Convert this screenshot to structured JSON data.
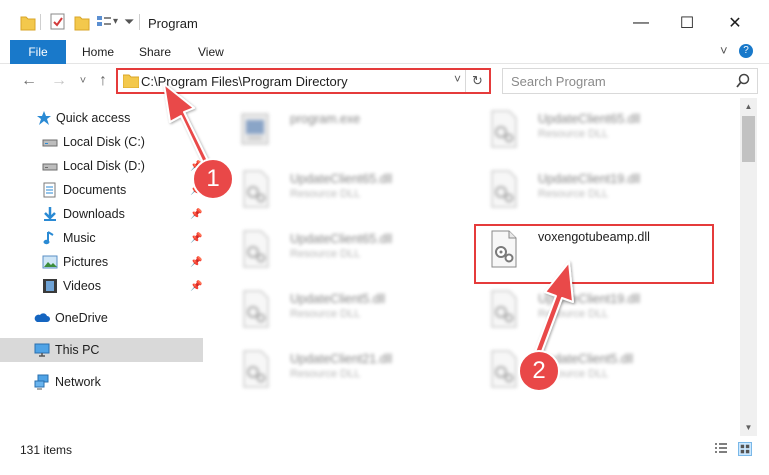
{
  "window": {
    "title": "Program",
    "minimize_glyph": "—",
    "maximize_glyph": "☐",
    "close_glyph": "✕"
  },
  "ribbon": {
    "tabs": [
      "File",
      "Home",
      "Share",
      "View"
    ],
    "collapse_glyph": "˅",
    "help_glyph": "?"
  },
  "nav": {
    "back_glyph": "←",
    "forward_glyph": "→",
    "recent_glyph": "˅",
    "up_glyph": "↑",
    "address": "C:\\Program Files\\Program Directory",
    "address_dropdown_glyph": "˅",
    "refresh_glyph": "↻",
    "search_placeholder": "Search Program"
  },
  "sidebar": {
    "items": [
      {
        "label": "Quick access",
        "icon": "star-icon"
      },
      {
        "label": "Local Disk (C:)",
        "icon": "drive-icon"
      },
      {
        "label": "Local Disk (D:)",
        "icon": "drive-icon"
      },
      {
        "label": "Documents",
        "icon": "documents-icon"
      },
      {
        "label": "Downloads",
        "icon": "download-icon"
      },
      {
        "label": "Music",
        "icon": "music-icon"
      },
      {
        "label": "Pictures",
        "icon": "pictures-icon"
      },
      {
        "label": "Videos",
        "icon": "videos-icon"
      },
      {
        "label": "OneDrive",
        "icon": "cloud-icon"
      },
      {
        "label": "This PC",
        "icon": "computer-icon"
      },
      {
        "label": "Network",
        "icon": "network-icon"
      }
    ],
    "pin_glyph": "📌"
  },
  "files": [
    {
      "name": "program.exe",
      "type": ""
    },
    {
      "name": "UpdateClient65.dll",
      "type": "Resource DLL"
    },
    {
      "name": "UpdateClient65.dll",
      "type": "Resource DLL"
    },
    {
      "name": "UpdateClient19.dll",
      "type": "Resource DLL"
    },
    {
      "name": "UpdateClient65.dll",
      "type": "Resource DLL"
    },
    {
      "name": "voxengotubeamp.dll",
      "type": ""
    },
    {
      "name": "UpdateClient5.dll",
      "type": "Resource DLL"
    },
    {
      "name": "UpdateClient19.dll",
      "type": "Resource DLL"
    },
    {
      "name": "UpdateClient21.dll",
      "type": "Resource DLL"
    },
    {
      "name": "UpdateClient5.dll",
      "type": "Resource DLL"
    }
  ],
  "status": {
    "item_count": "131 items"
  },
  "annotations": {
    "step1": "1",
    "step2": "2",
    "color": "#e94848"
  },
  "colors": {
    "accent": "#1979ca",
    "highlight": "#e53b3b",
    "selection": "#cce8ff"
  }
}
